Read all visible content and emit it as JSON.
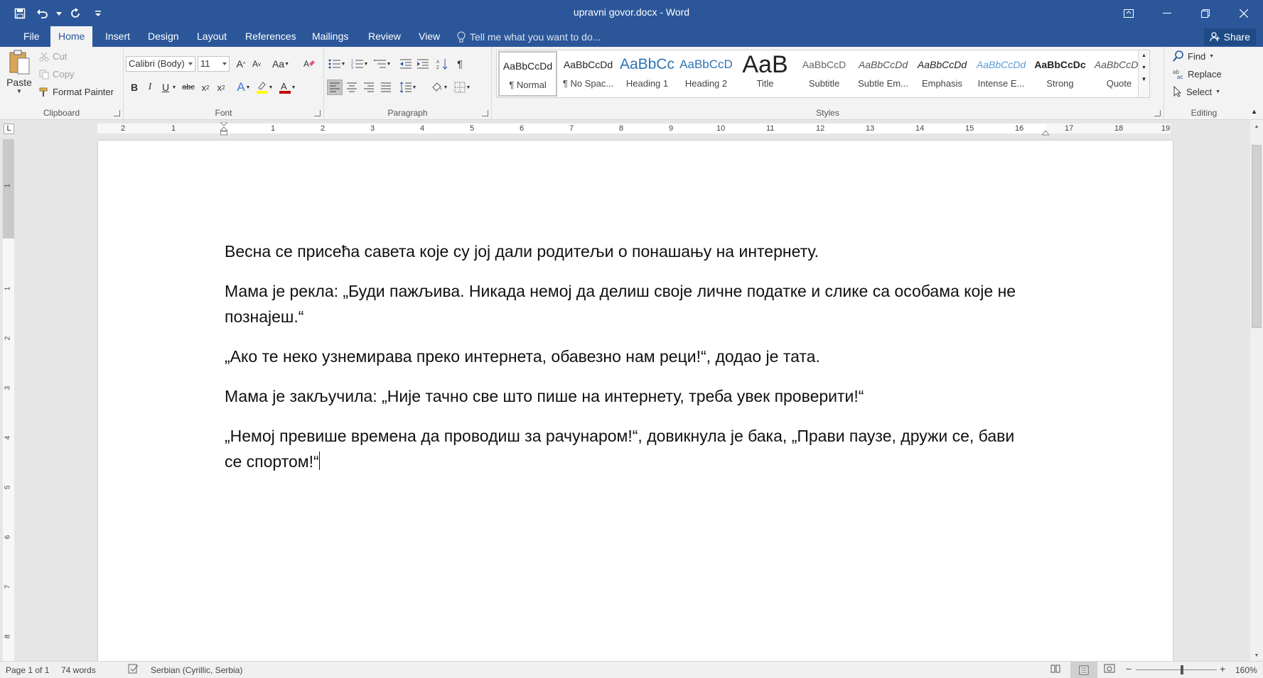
{
  "window": {
    "title": "upravni govor.docx - Word"
  },
  "tabs": [
    {
      "label": "File"
    },
    {
      "label": "Home"
    },
    {
      "label": "Insert"
    },
    {
      "label": "Design"
    },
    {
      "label": "Layout"
    },
    {
      "label": "References"
    },
    {
      "label": "Mailings"
    },
    {
      "label": "Review"
    },
    {
      "label": "View"
    }
  ],
  "tell_me": "Tell me what you want to do...",
  "share_label": "Share",
  "clipboard": {
    "paste": "Paste",
    "cut": "Cut",
    "copy": "Copy",
    "format_painter": "Format Painter",
    "label": "Clipboard"
  },
  "font": {
    "name": "Calibri (Body)",
    "size": "11",
    "change_case": "Aa",
    "label": "Font"
  },
  "paragraph": {
    "label": "Paragraph"
  },
  "styles": {
    "label": "Styles",
    "items": [
      {
        "preview": "AaBbCcDd",
        "name": "¶ Normal"
      },
      {
        "preview": "AaBbCcDd",
        "name": "¶ No Spac..."
      },
      {
        "preview": "AaBbCc",
        "name": "Heading 1"
      },
      {
        "preview": "AaBbCcD",
        "name": "Heading 2"
      },
      {
        "preview": "AaB",
        "name": "Title"
      },
      {
        "preview": "AaBbCcD",
        "name": "Subtitle"
      },
      {
        "preview": "AaBbCcDd",
        "name": "Subtle Em..."
      },
      {
        "preview": "AaBbCcDd",
        "name": "Emphasis"
      },
      {
        "preview": "AaBbCcDd",
        "name": "Intense E..."
      },
      {
        "preview": "AaBbCcDc",
        "name": "Strong"
      },
      {
        "preview": "AaBbCcDd",
        "name": "Quote"
      }
    ]
  },
  "editing": {
    "find": "Find",
    "replace": "Replace",
    "select": "Select",
    "label": "Editing"
  },
  "ruler": {
    "numbers": [
      "2",
      "1",
      "1",
      "2",
      "3",
      "4",
      "5",
      "6",
      "7",
      "8",
      "9",
      "10",
      "11",
      "12",
      "13",
      "14",
      "15",
      "16",
      "17",
      "18",
      "19"
    ],
    "tab_marker": "L",
    "vertical_numbers": [
      "1",
      "1",
      "2",
      "3",
      "4",
      "5",
      "6",
      "7",
      "8"
    ]
  },
  "document": {
    "paragraphs": [
      "Весна се присећа савета које су јој дали родитељи о понашању на интернету.",
      "Мама је рекла: „Буди пажљива. Никада  немој да делиш своје личне податке и слике са особама које не познајеш.“",
      " „Ако те неко узнемирава преко интернета, обавезно нам реци!“, додао је тата.",
      "Мама је закључила: „Није тачно све што пише на интернету, треба увек проверити!“",
      "„Немој превише времена да проводиш за рачунаром!“, довикнула је бака,  „Прави паузе, дружи се, бави се спортом!“"
    ]
  },
  "status": {
    "page": "Page 1 of 1",
    "words": "74 words",
    "language": "Serbian (Cyrillic, Serbia)",
    "zoom": "160%"
  },
  "colors": {
    "accent": "#2b579a"
  }
}
